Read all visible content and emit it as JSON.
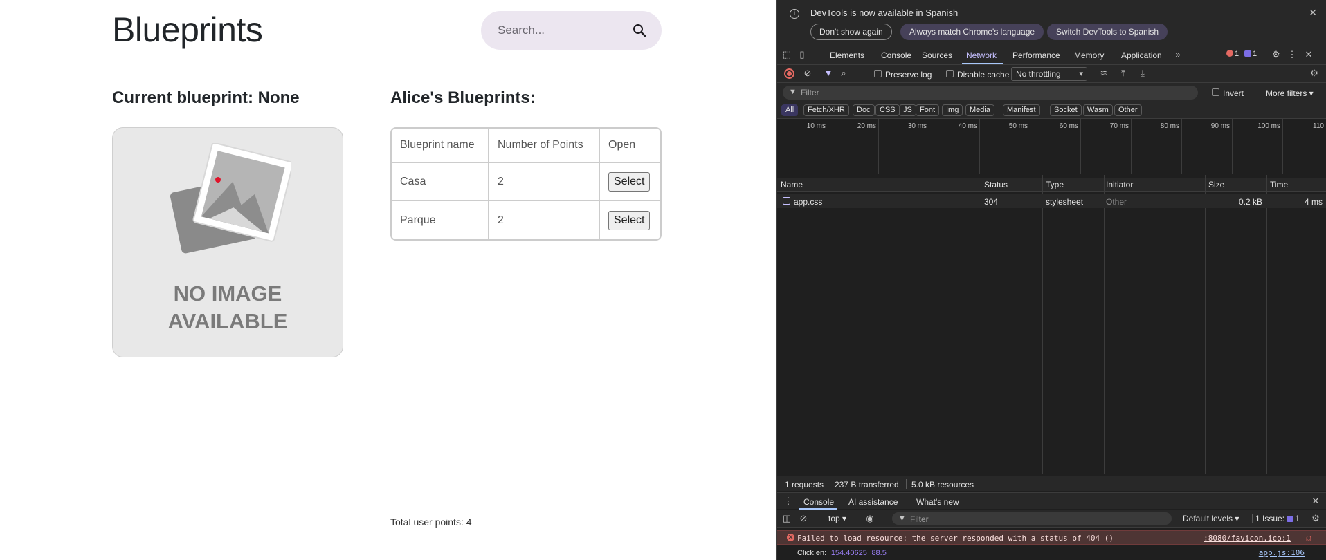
{
  "page": {
    "title": "Blueprints",
    "search_placeholder": "Search...",
    "current_blueprint": "Current blueprint: None",
    "user_blueprints_heading": "Alice's Blueprints:",
    "no_image_line1": "NO IMAGE",
    "no_image_line2": "AVAILABLE",
    "table": {
      "headers": [
        "Blueprint name",
        "Number of Points",
        "Open"
      ],
      "rows": [
        {
          "name": "Casa",
          "points": "2",
          "action": "Select"
        },
        {
          "name": "Parque",
          "points": "2",
          "action": "Select"
        }
      ]
    },
    "total": "Total user points: 4"
  },
  "devtools": {
    "infobar": {
      "message": "DevTools is now available in Spanish",
      "btn_dont_show": "Don't show again",
      "btn_match": "Always match Chrome's language",
      "btn_switch": "Switch DevTools to Spanish"
    },
    "tabs": [
      "Elements",
      "Console",
      "Sources",
      "Network",
      "Performance",
      "Memory",
      "Application"
    ],
    "active_tab": "Network",
    "errors_count": "1",
    "messages_count": "1",
    "toolbar": {
      "preserve_log": "Preserve log",
      "disable_cache": "Disable cache",
      "throttling": "No throttling"
    },
    "filter": {
      "placeholder": "Filter",
      "invert": "Invert",
      "more_filters": "More filters"
    },
    "types": [
      "All",
      "Fetch/XHR",
      "Doc",
      "CSS",
      "JS",
      "Font",
      "Img",
      "Media",
      "Manifest",
      "Socket",
      "Wasm",
      "Other"
    ],
    "timeline_labels": [
      "10 ms",
      "20 ms",
      "30 ms",
      "40 ms",
      "50 ms",
      "60 ms",
      "70 ms",
      "80 ms",
      "90 ms",
      "100 ms",
      "110"
    ],
    "columns": [
      "Name",
      "Status",
      "Type",
      "Initiator",
      "Size",
      "Time"
    ],
    "requests": [
      {
        "name": "app.css",
        "status": "304",
        "type": "stylesheet",
        "initiator": "Other",
        "size": "0.2 kB",
        "time": "4 ms"
      }
    ],
    "status": {
      "requests": "1 requests",
      "transferred": "237 B transferred",
      "resources": "5.0 kB resources"
    },
    "drawer_tabs": [
      "Console",
      "AI assistance",
      "What's new"
    ],
    "console": {
      "context": "top",
      "filter": "Filter",
      "levels": "Default levels",
      "issues": "1 Issue:",
      "issues_count": "1",
      "error_message": "Failed to load resource: the server responded with a status of 404 ()",
      "error_source": ":8080/favicon.ico:1",
      "log_prefix": "Click en:",
      "log_x": "154.40625",
      "log_y": "88.5",
      "log_source": "app.js:106"
    }
  },
  "colors": {
    "accent": "#c6c0ff",
    "error": "#e46962",
    "search_bg": "#ece6f0"
  }
}
